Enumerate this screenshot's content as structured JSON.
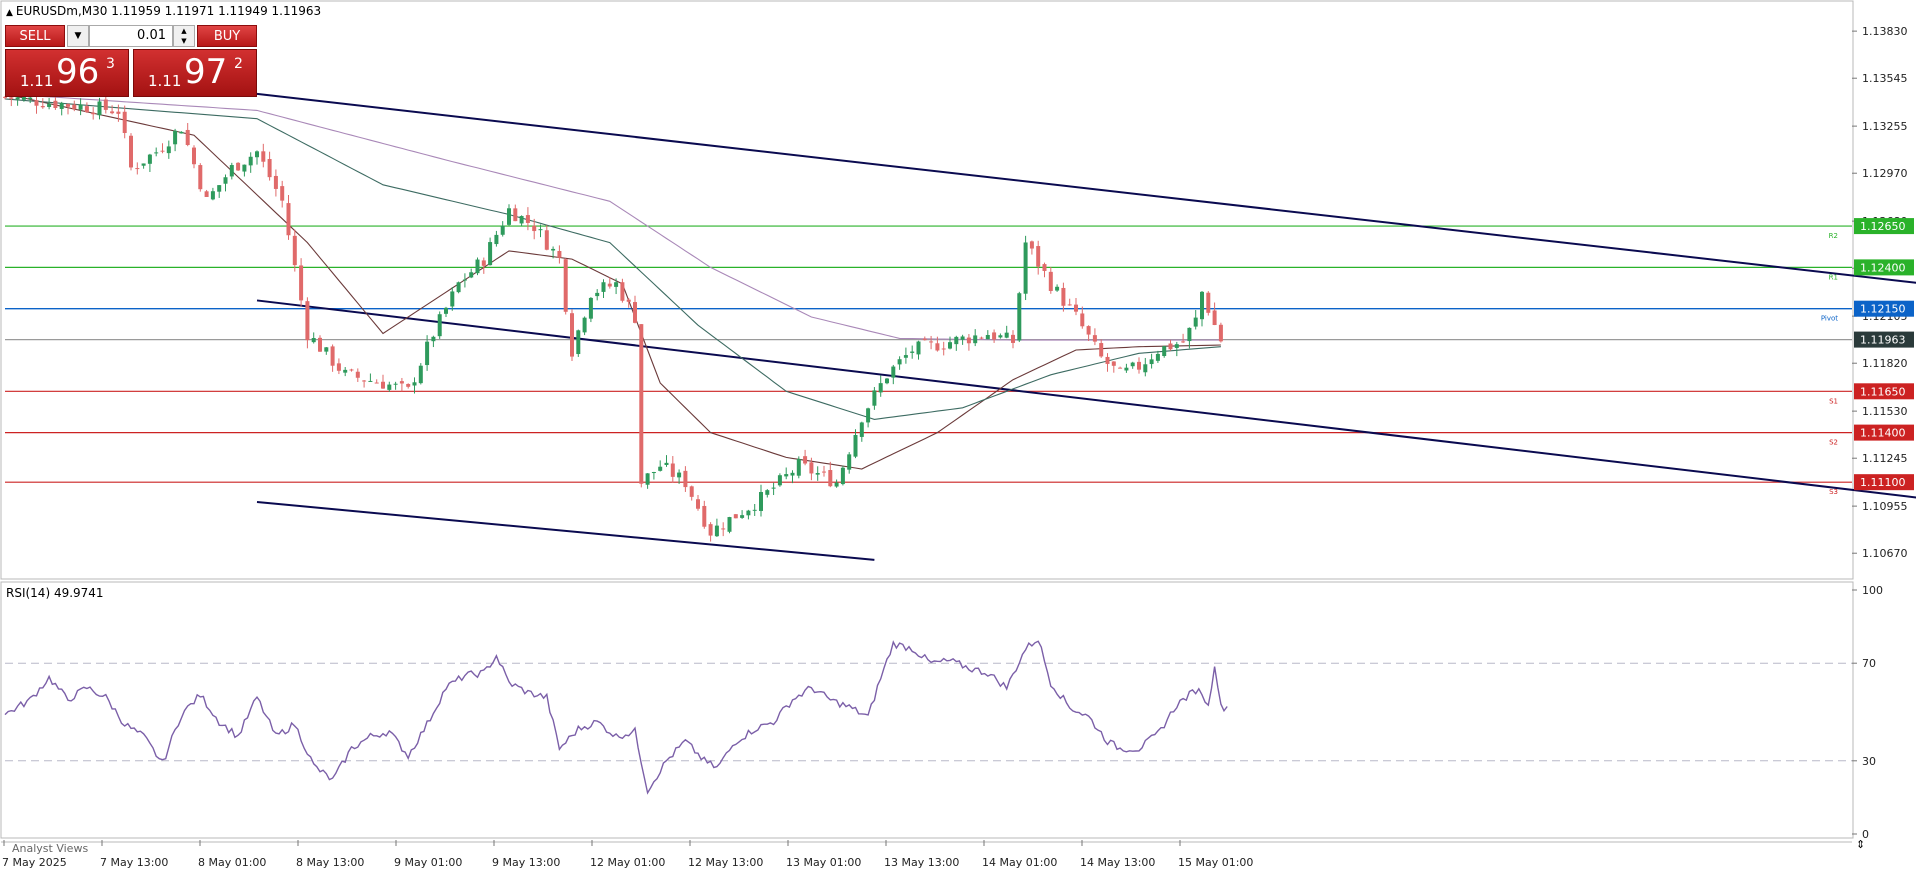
{
  "window": {
    "symbol_title": "EURUSDm,M30  1.11959 1.11971 1.11949 1.11963",
    "rsi_label": "RSI(14) 49.9741",
    "analyst_views": "Analyst Views",
    "cursor_glyph": "⇕"
  },
  "trade_panel": {
    "sell_label": "SELL",
    "buy_label": "BUY",
    "volume": "0.01",
    "sell_small": "1.11",
    "sell_big": "96",
    "sell_sup": "3",
    "buy_small": "1.11",
    "buy_big": "97",
    "buy_sup": "2"
  },
  "colors": {
    "bull": "#2e9a5c",
    "bear": "#e06a6a",
    "resistance": "#2ab22a",
    "pivot": "#0b63c8",
    "support": "#cc2222",
    "channel": "#0a0a50",
    "current": "#2a2a2a",
    "rsi": "#7b5fa8",
    "ma_fast": "#6b3a3a",
    "ma_mid": "#3d6b62",
    "ma_slow": "#a988b8"
  },
  "chart_data": {
    "type": "candlestick",
    "symbol": "EURUSDm",
    "timeframe": "M30",
    "ohlc_header": {
      "open": 1.11959,
      "high": 1.11971,
      "low": 1.11949,
      "close": 1.11963
    },
    "y_ticks": [
      "1.13830",
      "1.13545",
      "1.13255",
      "1.12970",
      "1.12680",
      "1.12395",
      "1.12105",
      "1.11820",
      "1.11530",
      "1.11245",
      "1.10955",
      "1.10670"
    ],
    "ylim": [
      1.1052,
      1.1397
    ],
    "x_ticks": [
      "7 May 2025",
      "7 May 13:00",
      "8 May 01:00",
      "8 May 13:00",
      "9 May 01:00",
      "9 May 13:00",
      "12 May 01:00",
      "12 May 13:00",
      "13 May 01:00",
      "13 May 13:00",
      "14 May 01:00",
      "14 May 13:00",
      "15 May 01:00"
    ],
    "levels": [
      {
        "price": "1.12650",
        "label": "R2",
        "kind": "resistance"
      },
      {
        "price": "1.12400",
        "label": "R1",
        "kind": "resistance"
      },
      {
        "price": "1.12150",
        "label": "Pivot",
        "kind": "pivot"
      },
      {
        "price": "1.11963",
        "label": "",
        "kind": "current"
      },
      {
        "price": "1.11650",
        "label": "S1",
        "kind": "support"
      },
      {
        "price": "1.11400",
        "label": "S2",
        "kind": "support"
      },
      {
        "price": "1.11100",
        "label": "S3",
        "kind": "support"
      }
    ],
    "close_path": [
      [
        0,
        1.1343
      ],
      [
        18,
        1.1335
      ],
      [
        20,
        1.13
      ],
      [
        24,
        1.131
      ],
      [
        28,
        1.1325
      ],
      [
        32,
        1.128
      ],
      [
        36,
        1.13
      ],
      [
        40,
        1.131
      ],
      [
        44,
        1.128
      ],
      [
        48,
        1.12
      ],
      [
        54,
        1.1175
      ],
      [
        60,
        1.117
      ],
      [
        64,
        1.1165
      ],
      [
        68,
        1.12
      ],
      [
        72,
        1.123
      ],
      [
        76,
        1.1245
      ],
      [
        80,
        1.1275
      ],
      [
        84,
        1.1265
      ],
      [
        88,
        1.1245
      ],
      [
        90,
        1.119
      ],
      [
        93,
        1.1225
      ],
      [
        97,
        1.123
      ],
      [
        100,
        1.121
      ],
      [
        101,
        1.111
      ],
      [
        104,
        1.112
      ],
      [
        108,
        1.111
      ],
      [
        112,
        1.108
      ],
      [
        116,
        1.109
      ],
      [
        120,
        1.11
      ],
      [
        126,
        1.112
      ],
      [
        132,
        1.111
      ],
      [
        136,
        1.115
      ],
      [
        140,
        1.1175
      ],
      [
        144,
        1.119
      ],
      [
        150,
        1.1195
      ],
      [
        156,
        1.12
      ],
      [
        160,
        1.1195
      ],
      [
        162,
        1.1255
      ],
      [
        166,
        1.123
      ],
      [
        170,
        1.121
      ],
      [
        174,
        1.1185
      ],
      [
        177,
        1.1175
      ],
      [
        180,
        1.118
      ],
      [
        183,
        1.119
      ],
      [
        187,
        1.1195
      ],
      [
        189,
        1.1208
      ],
      [
        190,
        1.1225
      ],
      [
        192,
        1.1205
      ],
      [
        193,
        1.1196
      ]
    ],
    "channel_lines": [
      {
        "name": "upper",
        "points": [
          [
            40,
            1.1345
          ],
          [
            305,
            1.123
          ]
        ]
      },
      {
        "name": "middle",
        "points": [
          [
            40,
            1.122
          ],
          [
            305,
            1.11
          ]
        ]
      },
      {
        "name": "lower",
        "points": [
          [
            40,
            1.1098
          ],
          [
            138,
            1.1063
          ]
        ]
      }
    ],
    "moving_averages": [
      {
        "name": "fast",
        "points": [
          [
            0,
            1.1345
          ],
          [
            30,
            1.132
          ],
          [
            48,
            1.1255
          ],
          [
            60,
            1.12
          ],
          [
            72,
            1.123
          ],
          [
            80,
            1.125
          ],
          [
            90,
            1.1245
          ],
          [
            98,
            1.123
          ],
          [
            104,
            1.117
          ],
          [
            112,
            1.114
          ],
          [
            124,
            1.1125
          ],
          [
            136,
            1.1118
          ],
          [
            148,
            1.114
          ],
          [
            160,
            1.1172
          ],
          [
            170,
            1.119
          ],
          [
            180,
            1.1192
          ],
          [
            193,
            1.1193
          ]
        ]
      },
      {
        "name": "mid",
        "points": [
          [
            0,
            1.1342
          ],
          [
            40,
            1.133
          ],
          [
            60,
            1.129
          ],
          [
            80,
            1.1272
          ],
          [
            96,
            1.1255
          ],
          [
            110,
            1.1205
          ],
          [
            124,
            1.1165
          ],
          [
            138,
            1.1148
          ],
          [
            152,
            1.1155
          ],
          [
            166,
            1.1175
          ],
          [
            180,
            1.1188
          ],
          [
            193,
            1.1192
          ]
        ]
      },
      {
        "name": "slow",
        "points": [
          [
            0,
            1.1345
          ],
          [
            40,
            1.1335
          ],
          [
            70,
            1.1305
          ],
          [
            96,
            1.128
          ],
          [
            112,
            1.124
          ],
          [
            128,
            1.121
          ],
          [
            142,
            1.1197
          ],
          [
            160,
            1.1196
          ],
          [
            180,
            1.1196
          ],
          [
            193,
            1.1196
          ]
        ]
      }
    ],
    "rsi": {
      "period": 14,
      "value": 49.9741,
      "ylim": [
        0,
        100
      ],
      "levels": [
        30,
        70
      ],
      "y_ticks": [
        "100",
        "70",
        "30",
        "0"
      ],
      "points": [
        [
          0,
          49
        ],
        [
          4,
          55
        ],
        [
          7,
          64
        ],
        [
          10,
          55
        ],
        [
          13,
          60
        ],
        [
          16,
          56
        ],
        [
          19,
          45
        ],
        [
          22,
          40
        ],
        [
          25,
          29
        ],
        [
          28,
          49
        ],
        [
          31,
          57
        ],
        [
          34,
          46
        ],
        [
          37,
          40
        ],
        [
          40,
          56
        ],
        [
          43,
          40
        ],
        [
          46,
          45
        ],
        [
          49,
          28
        ],
        [
          52,
          22
        ],
        [
          55,
          35
        ],
        [
          58,
          40
        ],
        [
          61,
          42
        ],
        [
          64,
          32
        ],
        [
          67,
          45
        ],
        [
          70,
          60
        ],
        [
          73,
          65
        ],
        [
          76,
          66
        ],
        [
          78,
          73
        ],
        [
          80,
          62
        ],
        [
          83,
          58
        ],
        [
          86,
          56
        ],
        [
          88,
          35
        ],
        [
          91,
          43
        ],
        [
          94,
          46
        ],
        [
          97,
          40
        ],
        [
          100,
          42
        ],
        [
          102,
          18
        ],
        [
          105,
          30
        ],
        [
          108,
          38
        ],
        [
          111,
          30
        ],
        [
          113,
          27
        ],
        [
          116,
          38
        ],
        [
          119,
          43
        ],
        [
          122,
          46
        ],
        [
          125,
          55
        ],
        [
          128,
          60
        ],
        [
          131,
          55
        ],
        [
          134,
          52
        ],
        [
          137,
          48
        ],
        [
          139,
          64
        ],
        [
          141,
          78
        ],
        [
          144,
          76
        ],
        [
          147,
          70
        ],
        [
          150,
          71
        ],
        [
          153,
          68
        ],
        [
          156,
          66
        ],
        [
          159,
          60
        ],
        [
          162,
          76
        ],
        [
          164,
          80
        ],
        [
          166,
          62
        ],
        [
          169,
          52
        ],
        [
          172,
          48
        ],
        [
          175,
          38
        ],
        [
          177,
          35
        ],
        [
          180,
          35
        ],
        [
          183,
          41
        ],
        [
          186,
          53
        ],
        [
          189,
          59
        ],
        [
          190,
          58
        ],
        [
          191,
          52
        ],
        [
          192,
          70
        ],
        [
          193,
          52
        ],
        [
          194,
          52
        ]
      ]
    }
  }
}
